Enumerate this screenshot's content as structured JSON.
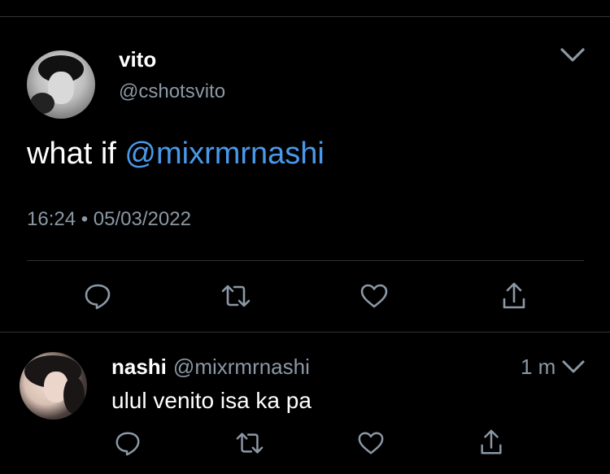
{
  "tweet": {
    "author": {
      "display_name": "vito",
      "handle": "@cshotsvito"
    },
    "text_prefix": "what if ",
    "mention": "@mixrmrnashi",
    "timestamp": "16:24 • 05/03/2022"
  },
  "actions": [
    "reply-icon",
    "retweet-icon",
    "like-icon",
    "share-icon"
  ],
  "reply": {
    "author": {
      "display_name": "nashi",
      "handle": "@mixrmrnashi"
    },
    "time_ago": "1 m",
    "text": "ulul venito isa ka pa"
  },
  "colors": {
    "background": "#000000",
    "text": "#ffffff",
    "secondary": "#8b98a5",
    "mention": "#4a99e9",
    "divider": "#2f3336"
  }
}
